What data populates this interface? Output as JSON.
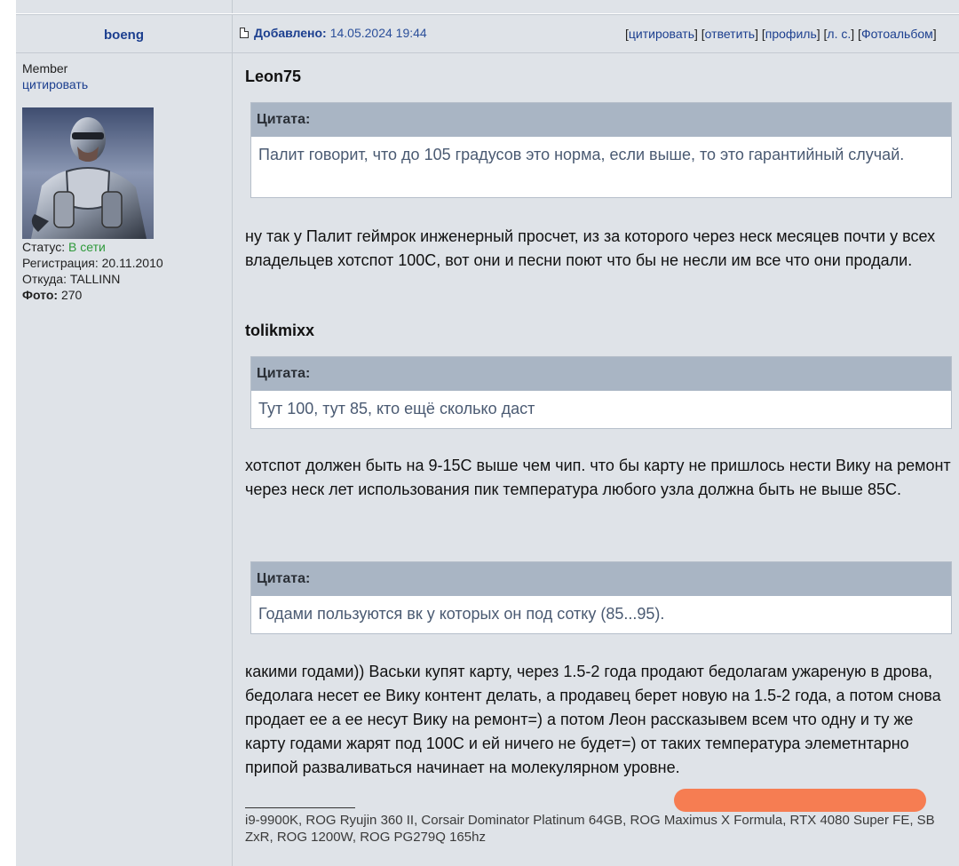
{
  "post": {
    "author": "boeng",
    "added_label": "Добавлено:",
    "date": "14.05.2024 19:44",
    "actions": [
      "цитировать",
      "ответить",
      "профиль",
      "л. с.",
      "Фотоальбом"
    ]
  },
  "sidebar": {
    "rank": "Member",
    "quote_link": "цитировать",
    "status_label": "Статус:",
    "status_value": "В сети",
    "registration": "Регистрация: 20.11.2010",
    "location": "Откуда: TALLINN",
    "photo_label": "Фото:",
    "photo_count": "270"
  },
  "body": {
    "quote_header": "Цитата:",
    "user1": "Leon75",
    "quote1": "Палит говорит, что до 105 градусов это норма, если выше, то это гарантийный случай.",
    "text1": "ну так у Палит геймрок инженерный просчет, из за которого через неск месяцев почти у всех владельцев хотспот 100С, вот они и песни поют что бы не несли им все что они продали.",
    "user2": "tolikmixx",
    "quote2": "Тут 100, тут 85, кто ещё сколько даст",
    "text2": "хотспот должен быть на 9-15С выше чем чип. что бы карту не пришлось нести Вику на ремонт через неск лет использования пик температура любого узла должна быть не выше 85С.",
    "quote3": "Годами пользуются вк у которых он под сотку (85...95).",
    "text3": "какими годами)) Васьки купят карту, через 1.5-2 года продают бедолагам ужареную в дрова, бедолага несет ее Вику контент делать, а продавец берет новую на 1.5-2 года, а потом снова продает ее а ее несут Вику на ремонт=) а потом Леон рассказывем всем что одну и ту же карту годами жарят под 100С и ей ничего не будет=) от таких температура элеметнтарно припой разваливаться начинает на молекулярном уровне.",
    "signature": "i9-9900K, ROG Ryujin 360 II, Corsair Dominator Platinum 64GB, ROG Maximus X Formula, RTX 4080 Super FE, SB ZxR, ROG 1200W, ROG PG279Q 165hz"
  }
}
